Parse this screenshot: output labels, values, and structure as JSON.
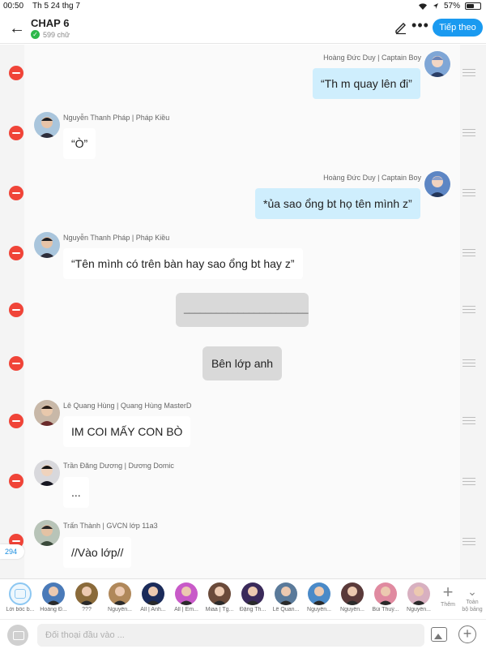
{
  "status_bar": {
    "time": "00:50",
    "date": "Th 5 24 thg 7",
    "battery": "57%",
    "battery_level": 0.57
  },
  "header": {
    "title": "CHAP 6",
    "word_count": "599 chữ",
    "next_label": "Tiếp theo"
  },
  "messages": [
    {
      "type": "right",
      "name": "Hoàng Đức Duy | Captain Boy",
      "text": "“Th m quay lên đi”"
    },
    {
      "type": "left",
      "name": "Nguyễn Thanh Pháp | Pháp Kiều",
      "text": "“Ò”"
    },
    {
      "type": "right",
      "name": "Hoàng Đức Duy | Captain Boy",
      "text": "*ủa sao ổng bt họ tên mình z”"
    },
    {
      "type": "left",
      "name": "Nguyễn Thanh Pháp | Pháp Kiều",
      "text": "“Tên mình có trên bàn hay sao ổng bt hay z”"
    },
    {
      "type": "center",
      "text": "_______________________"
    },
    {
      "type": "center",
      "text": "Bên lớp anh"
    },
    {
      "type": "left",
      "name": "Lê Quang Hùng | Quang Hùng MasterD",
      "text": "IM COI MẤY CON BÒ"
    },
    {
      "type": "left",
      "name": "Trần Đăng Dương | Dương Domic",
      "text": "..."
    },
    {
      "type": "left",
      "name": "Trấn Thành | GVCN lớp 11a3",
      "text": "//Vào lớp//"
    }
  ],
  "message_count": "294",
  "characters": [
    {
      "label": "Lời bốc b...",
      "kind": "narrator"
    },
    {
      "label": "Hoàng Đ...",
      "color": "#4a7ab8"
    },
    {
      "label": "???",
      "color": "#8a6a3a"
    },
    {
      "label": "Nguyễn...",
      "color": "#b0885a"
    },
    {
      "label": "All | Anh...",
      "color": "#1b2b5a"
    },
    {
      "label": "All | Em...",
      "color": "#c85ac8"
    },
    {
      "label": "Miaa | Tg...",
      "color": "#6a4a3a"
    },
    {
      "label": "Đặng Th...",
      "color": "#3a2a5a"
    },
    {
      "label": "Lê Quan...",
      "color": "#5a7a9a"
    },
    {
      "label": "Nguyễn...",
      "color": "#4a8ac8"
    },
    {
      "label": "Nguyễn...",
      "color": "#5a3a3a"
    },
    {
      "label": "Bùi Thuý...",
      "color": "#e08aa0"
    },
    {
      "label": "Nguyễn...",
      "color": "#d8b0c0"
    }
  ],
  "add_label": "Thêm",
  "all_label_1": "Toàn",
  "all_label_2": "bộ bảng",
  "input": {
    "placeholder": "Đối thoại đầu vào ..."
  },
  "colors": {
    "accent": "#1a9af0",
    "right_bubble": "#cfeefd",
    "delete": "#f04438"
  }
}
